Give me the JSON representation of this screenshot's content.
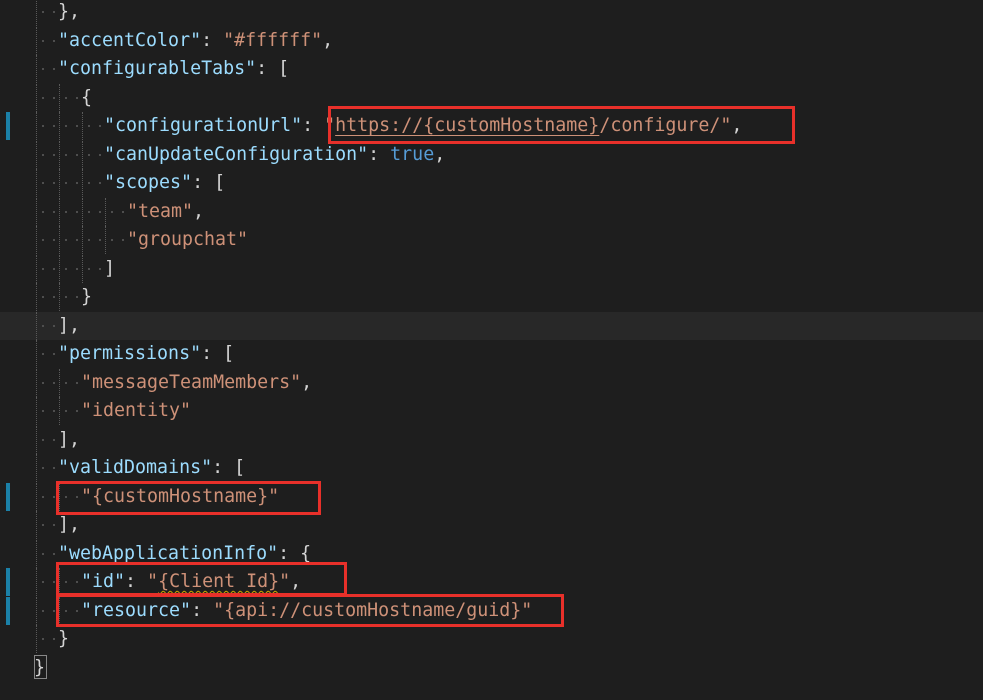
{
  "editor": {
    "lines": [
      [
        {
          "t": "},",
          "c": "p"
        }
      ],
      [
        {
          "t": "\"accentColor\"",
          "c": "k"
        },
        {
          "t": ": ",
          "c": "p"
        },
        {
          "t": "\"#ffffff\"",
          "c": "s"
        },
        {
          "t": ",",
          "c": "p"
        }
      ],
      [
        {
          "t": "\"configurableTabs\"",
          "c": "k"
        },
        {
          "t": ": [",
          "c": "p"
        }
      ],
      [
        {
          "t": "{",
          "c": "p"
        }
      ],
      [
        {
          "t": "\"configurationUrl\"",
          "c": "k"
        },
        {
          "t": ": ",
          "c": "p"
        },
        {
          "t": "\"",
          "c": "s"
        },
        {
          "t": "https://{customHostname}",
          "c": "s link-ul"
        },
        {
          "t": "/configure/\"",
          "c": "s"
        },
        {
          "t": ",",
          "c": "p"
        }
      ],
      [
        {
          "t": "\"canUpdateConfiguration\"",
          "c": "k"
        },
        {
          "t": ": ",
          "c": "p"
        },
        {
          "t": "true",
          "c": "b"
        },
        {
          "t": ",",
          "c": "p"
        }
      ],
      [
        {
          "t": "\"scopes\"",
          "c": "k"
        },
        {
          "t": ": [",
          "c": "p"
        }
      ],
      [
        {
          "t": "\"team\"",
          "c": "s"
        },
        {
          "t": ",",
          "c": "p"
        }
      ],
      [
        {
          "t": "\"groupchat\"",
          "c": "s"
        }
      ],
      [
        {
          "t": "]",
          "c": "p"
        }
      ],
      [
        {
          "t": "}",
          "c": "p"
        }
      ],
      [
        {
          "t": "],",
          "c": "p"
        }
      ],
      [
        {
          "t": "\"permissions\"",
          "c": "k"
        },
        {
          "t": ": [",
          "c": "p"
        }
      ],
      [
        {
          "t": "\"messageTeamMembers\"",
          "c": "s"
        },
        {
          "t": ",",
          "c": "p"
        }
      ],
      [
        {
          "t": "\"identity\"",
          "c": "s"
        }
      ],
      [
        {
          "t": "],",
          "c": "p"
        }
      ],
      [
        {
          "t": "\"validDomains\"",
          "c": "k"
        },
        {
          "t": ": [",
          "c": "p"
        }
      ],
      [
        {
          "t": "\"{customHostname}\"",
          "c": "s"
        }
      ],
      [
        {
          "t": "],",
          "c": "p"
        }
      ],
      [
        {
          "t": "\"webApplicationInfo\"",
          "c": "k"
        },
        {
          "t": ": {",
          "c": "p"
        }
      ],
      [
        {
          "t": "\"id\"",
          "c": "k"
        },
        {
          "t": ": ",
          "c": "p"
        },
        {
          "t": "\"",
          "c": "s"
        },
        {
          "t": "{Client Id}",
          "c": "s squiggle"
        },
        {
          "t": "\"",
          "c": "s"
        },
        {
          "t": ",",
          "c": "p"
        }
      ],
      [
        {
          "t": "\"resource\"",
          "c": "k"
        },
        {
          "t": ": ",
          "c": "p"
        },
        {
          "t": "\"{api://customHostname/guid}\"",
          "c": "s"
        }
      ],
      [
        {
          "t": "}",
          "c": "p"
        }
      ],
      [
        {
          "t": "}",
          "c": "p"
        }
      ]
    ]
  },
  "colors": {
    "background": "#1e1e1e",
    "key": "#9cdcfe",
    "string": "#ce9178",
    "boolean": "#569cd6",
    "punctuation": "#d4d4d4",
    "highlight_box": "#e8302a",
    "change_marker": "#1b81a8"
  }
}
